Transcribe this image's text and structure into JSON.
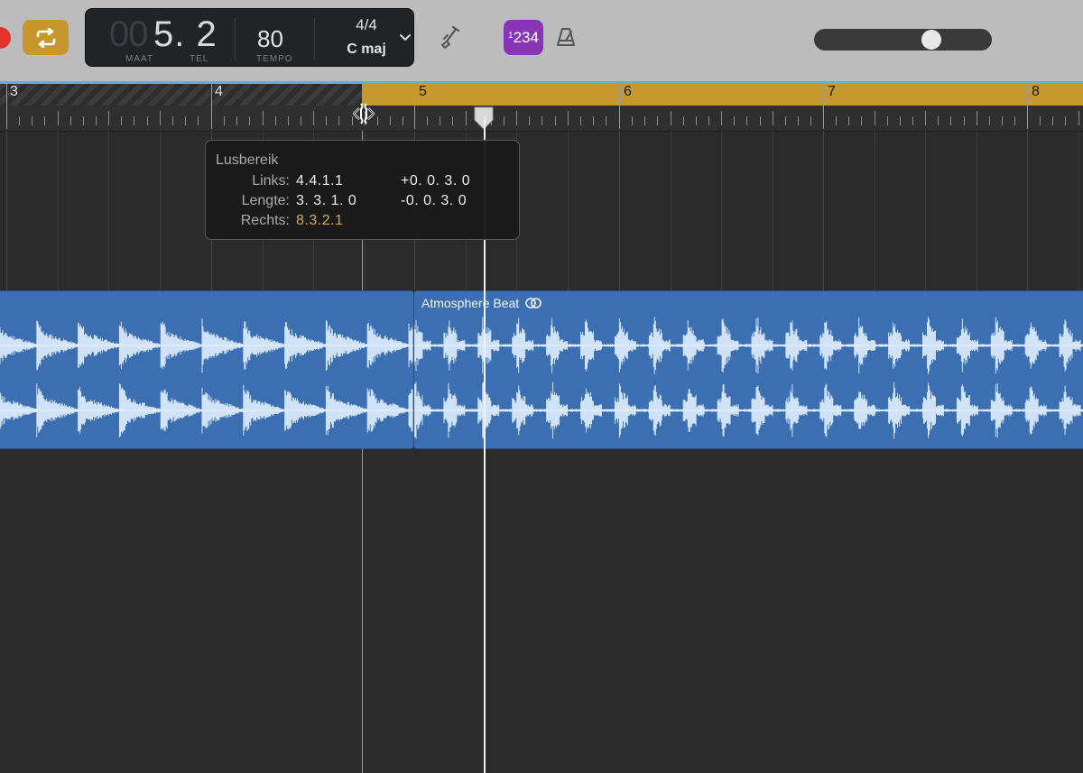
{
  "toolbar": {
    "position": {
      "dim": "00",
      "main": "5. 2"
    },
    "labels": {
      "bar": "MAAT",
      "beat": "TEL",
      "tempo": "TEMPO"
    },
    "tempo": "80",
    "signature": "4/4",
    "key": "C maj",
    "count_in": {
      "small": "1",
      "big": "234"
    },
    "master_volume": 0.68,
    "colors": {
      "cycle": "#c7962c",
      "count_in": "#8a35b6",
      "record": "#e0342c"
    },
    "icons": [
      "record-icon",
      "cycle-icon",
      "chevron-down-icon",
      "tuner-icon",
      "metronome-icon"
    ]
  },
  "ruler": {
    "bars": [
      "3",
      "4",
      "5",
      "6",
      "7",
      "8"
    ],
    "cycle_color": "#c6992e"
  },
  "tooltip": {
    "title": "Lusbereik",
    "rows": [
      {
        "key": "Links:",
        "value": "4.4.1.1",
        "delta": "+0. 0. 3. 0"
      },
      {
        "key": "Lengte:",
        "value": "3. 3. 1. 0",
        "delta": "-0. 0. 3. 0"
      },
      {
        "key": "Rechts:",
        "value": "8.3.2.1"
      }
    ]
  },
  "regions": [
    {
      "name": ""
    },
    {
      "name": "Atmosphere Beat",
      "icon": "loop-icon",
      "color": "#3b6fb1"
    }
  ]
}
